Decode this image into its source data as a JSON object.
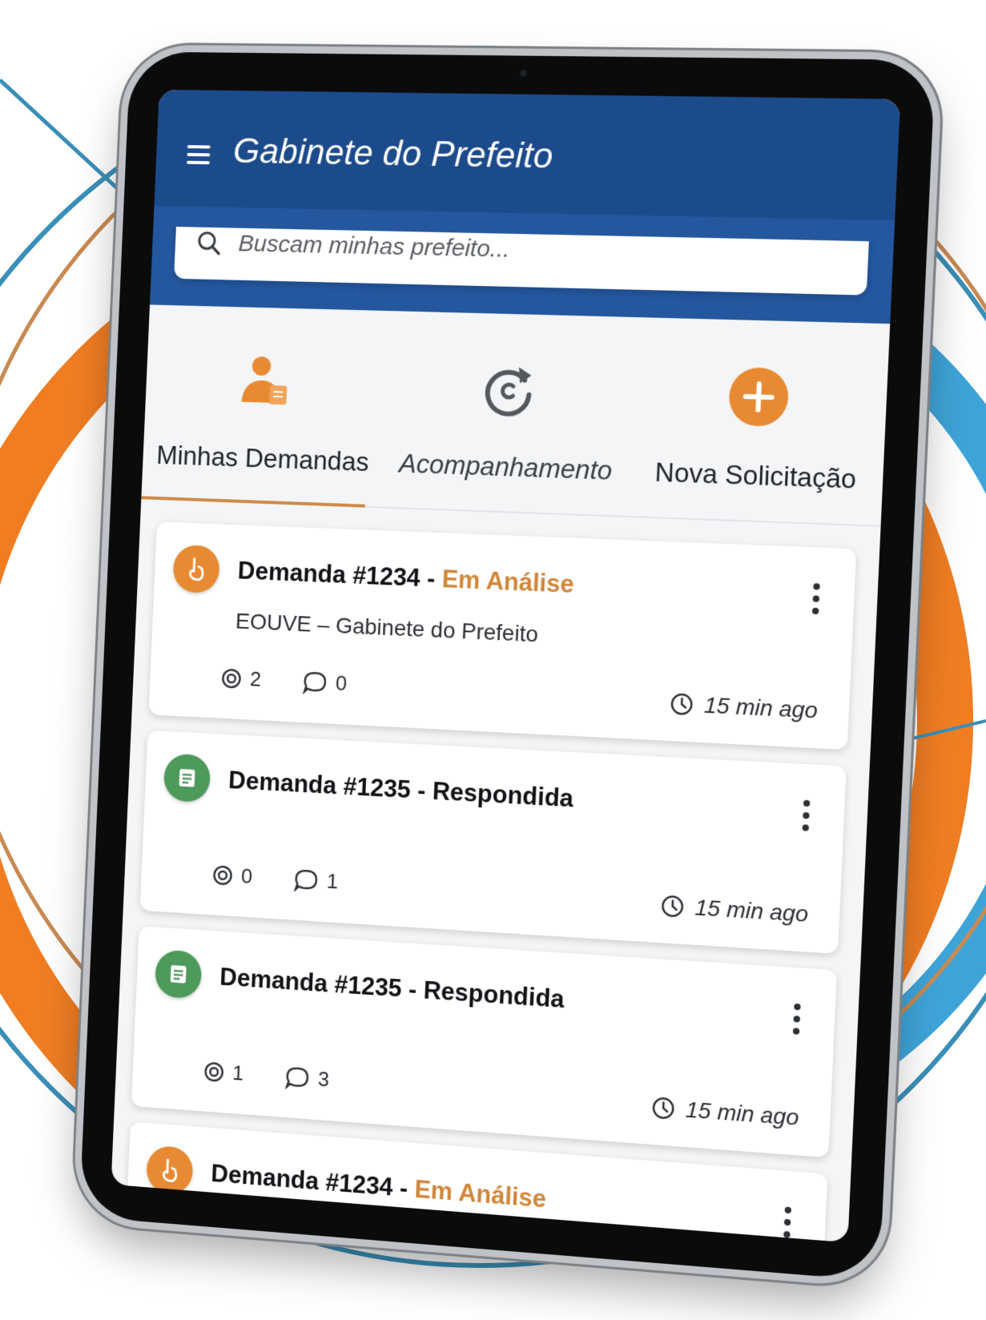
{
  "colors": {
    "primary": "#1c4b8c",
    "accent": "#e88a33",
    "success": "#4d9a5a"
  },
  "app_bar": {
    "title": "Gabinete do Prefeito",
    "menu_icon": "hamburger-icon"
  },
  "search": {
    "placeholder": "Buscam minhas prefeito...",
    "icon": "search-icon"
  },
  "tabs": [
    {
      "label": "Minhas Demandas",
      "icon": "person-document-icon",
      "active": true
    },
    {
      "label": "Acompanhamento",
      "icon": "refresh-icon",
      "active": false
    },
    {
      "label": "Nova Solicitação",
      "icon": "plus-circle-icon",
      "active": false
    }
  ],
  "demands": [
    {
      "number": "Demanda #1234",
      "separator": " - ",
      "status": "Em Análise",
      "subtitle": "EOUVE – Gabinete do Prefeito",
      "views": "2",
      "comments": "0",
      "time": "15 min ago"
    },
    {
      "number": "Demanda #1235",
      "separator": " - ",
      "status": "Respondida",
      "views": "0",
      "comments": "1",
      "time": "15 min ago"
    },
    {
      "number": "Demanda #1235",
      "separator": " - ",
      "status": "Respondida",
      "views": "1",
      "comments": "3",
      "time": "15 min ago"
    },
    {
      "number": "Demanda #1234",
      "separator": " - ",
      "status": "Em Análise"
    }
  ]
}
